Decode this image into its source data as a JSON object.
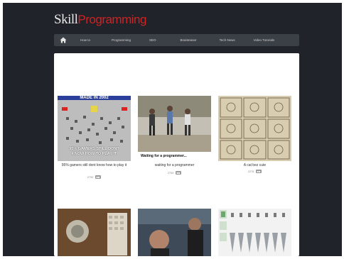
{
  "site": {
    "logo_left": "Skill",
    "logo_right": "Programming"
  },
  "nav": {
    "home_icon": "home-icon",
    "items": [
      {
        "label": "How to"
      },
      {
        "label": "Programming"
      },
      {
        "label": "SEO"
      },
      {
        "label": "Brainteaser"
      },
      {
        "label": "Tech News"
      },
      {
        "label": "Video Tutorials"
      }
    ]
  },
  "cards": [
    {
      "caption": "95% gamers still dont know how to play it",
      "meta": "2792",
      "meme_top": "MADE IN 2002",
      "meme_bottom1": "95% GAMERS STILL DONT",
      "meme_bottom2": "KNOW HOW TO PLAY IT"
    },
    {
      "caption": "waiting for a programmer",
      "meta": "2792",
      "overlay": "Waiting for a programmer..."
    },
    {
      "caption": "A cat bez cute",
      "meta": "2276"
    }
  ],
  "colors": {
    "frame": "#20232a",
    "nav": "#3b3f46",
    "logo_red": "#cf2323",
    "minesweeper_bg": "#bdbdbd",
    "meme_text": "#ffffff"
  }
}
